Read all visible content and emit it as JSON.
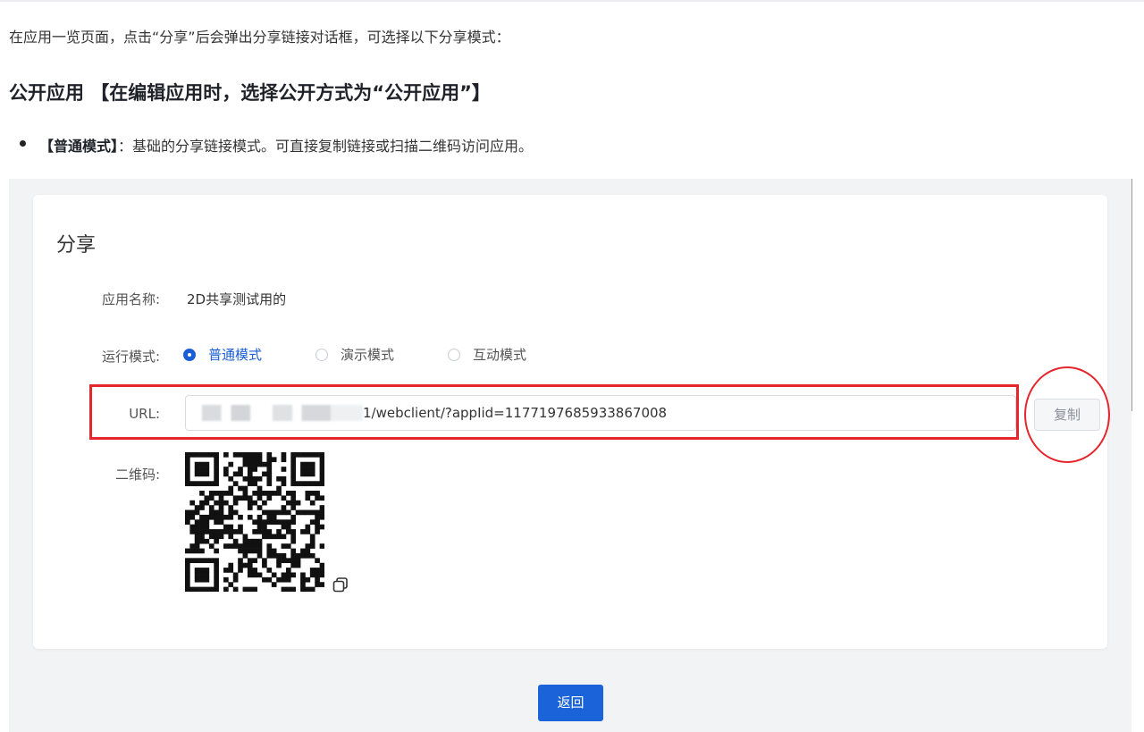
{
  "doc": {
    "intro": "在应用一览页面，点击“分享”后会弹出分享链接对话框，可选择以下分享模式：",
    "section_title": "公开应用 【在编辑应用时，选择公开方式为“公开应用”】",
    "bullet_bold": "【普通模式】",
    "bullet_text": "：基础的分享链接模式。可直接复制链接或扫描二维码访问应用。"
  },
  "dialog": {
    "title": "分享",
    "app_name_label": "应用名称:",
    "app_name_value": "2D共享测试用的",
    "mode_label": "运行模式:",
    "modes": [
      {
        "label": "普通模式",
        "checked": true
      },
      {
        "label": "演示模式",
        "checked": false
      },
      {
        "label": "互动模式",
        "checked": false
      }
    ],
    "url_label": "URL:",
    "url_visible_suffix": "1/webclient/?appIid=1177197685933867008",
    "copy_label": "复制",
    "qr_label": "二维码:",
    "back_label": "返回"
  },
  "colors": {
    "accent": "#1b63d9",
    "highlight": "#e6262d"
  },
  "icons": {
    "qr_copy": "copy-icon"
  }
}
